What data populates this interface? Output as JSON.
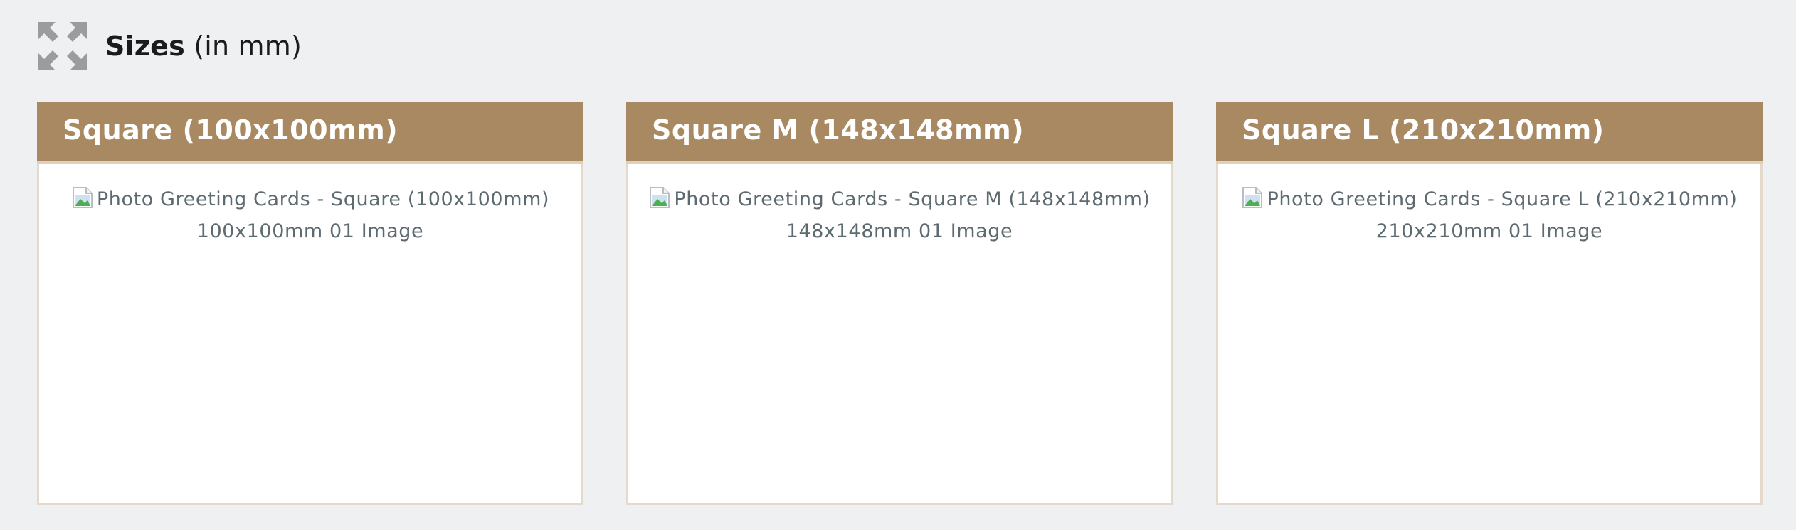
{
  "header": {
    "icon": "expand-arrows-icon",
    "title_bold": "Sizes",
    "title_light": "(in mm)"
  },
  "colors": {
    "page_background": "#eff0f2",
    "card_header": "#a98961",
    "card_border": "#e5d9cb",
    "body_text": "#5d6a70"
  },
  "cards": [
    {
      "title": "Square (100x100mm)",
      "image_alt": "Photo Greeting Cards - Square (100x100mm) 100x100mm 01 Image"
    },
    {
      "title": "Square M (148x148mm)",
      "image_alt": "Photo Greeting Cards - Square M (148x148mm) 148x148mm 01 Image"
    },
    {
      "title": "Square L (210x210mm)",
      "image_alt": "Photo Greeting Cards - Square L (210x210mm) 210x210mm 01 Image"
    }
  ]
}
